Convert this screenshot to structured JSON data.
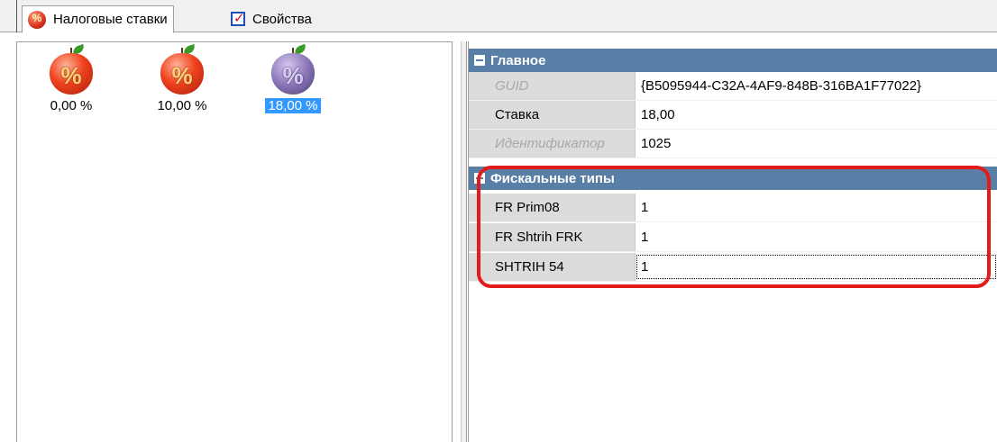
{
  "tabs": [
    {
      "label": "Налоговые ставки",
      "icon": "tax-apple-icon"
    },
    {
      "label": "Свойства",
      "icon": "checkbox-icon"
    }
  ],
  "rates": [
    {
      "label": "0,00 %",
      "icon_color": "red",
      "icon_text": "%",
      "selected": false
    },
    {
      "label": "10,00 %",
      "icon_color": "red",
      "icon_text": "%",
      "selected": false
    },
    {
      "label": "18,00 %",
      "icon_color": "violet",
      "icon_text": "%",
      "selected": true
    }
  ],
  "property_grid": {
    "categories": [
      {
        "name": "Главное",
        "properties": [
          {
            "name": "GUID",
            "value": "{B5095944-C32A-4AF9-848B-316BA1F77022}",
            "readonly": true
          },
          {
            "name": "Ставка",
            "value": "18,00",
            "readonly": false
          },
          {
            "name": "Идентификатор",
            "value": "1025",
            "readonly": true
          }
        ]
      },
      {
        "name": "Фискальные типы",
        "properties": [
          {
            "name": "FR Prim08",
            "value": "1",
            "readonly": false
          },
          {
            "name": "FR Shtrih FRK",
            "value": "1",
            "readonly": false
          },
          {
            "name": "SHTRIH 54",
            "value": "1",
            "readonly": false
          }
        ]
      }
    ]
  },
  "colors": {
    "category_header": "#5a7fa6",
    "selection": "#3399ff",
    "highlight": "#e21b1b"
  }
}
